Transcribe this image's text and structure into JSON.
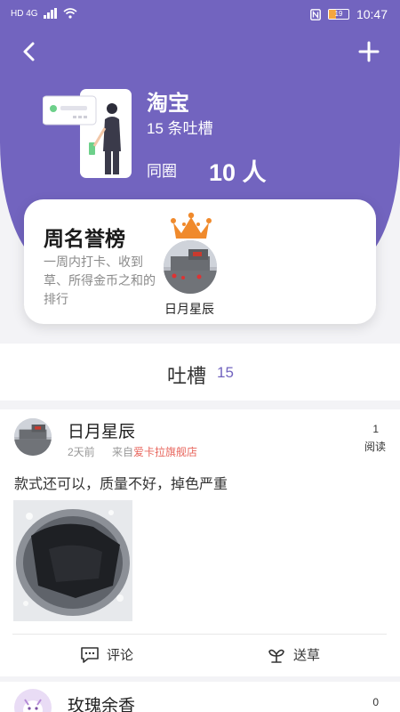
{
  "status_bar": {
    "network": "HD 4G",
    "time": "10:47",
    "battery": "19"
  },
  "header": {
    "title": "淘宝",
    "subtitle": "15 条吐槽",
    "circle_label": "同圈",
    "circle_count": "10 人"
  },
  "honor": {
    "title": "周名誉榜",
    "description": "一周内打卡、收到草、所得金币之和的排行",
    "top_user": "日月星辰"
  },
  "tabs": {
    "label": "吐槽",
    "count": "15"
  },
  "posts": [
    {
      "author": "日月星辰",
      "time": "2天前",
      "from_prefix": "来自",
      "shop": "爱卡拉旗舰店",
      "reads": "1",
      "reads_label": "阅读",
      "text": "款式还可以，质量不好，掉色严重",
      "comment_label": "评论",
      "give_label": "送草"
    },
    {
      "author": "玫瑰余香",
      "reads": "0"
    }
  ],
  "colors": {
    "brand": "#7264bf",
    "shop_link": "#e8665d",
    "crown": "#f08a2c"
  }
}
